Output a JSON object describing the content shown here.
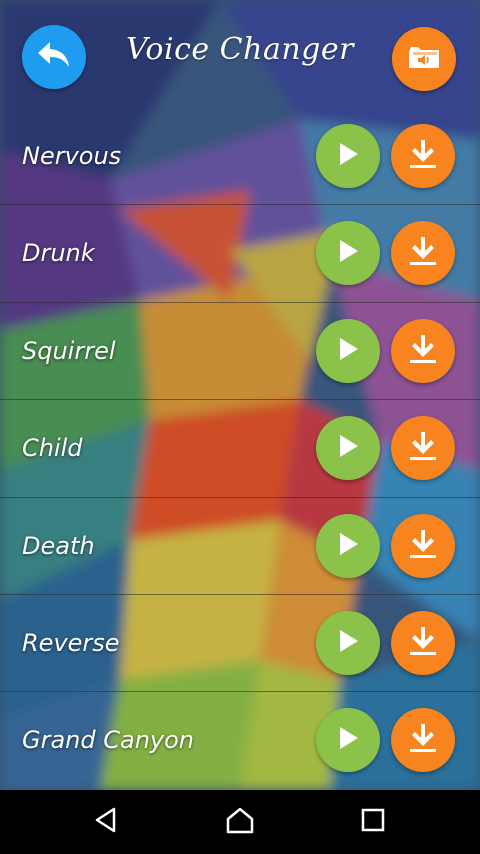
{
  "header": {
    "title": "Voice Changer",
    "back_icon": "back-arrow-icon",
    "folder_icon": "folder-audio-icon"
  },
  "effects": [
    {
      "label": "Nervous"
    },
    {
      "label": "Drunk"
    },
    {
      "label": "Squirrel"
    },
    {
      "label": "Child"
    },
    {
      "label": "Death"
    },
    {
      "label": "Reverse"
    },
    {
      "label": "Grand Canyon"
    }
  ],
  "colors": {
    "back_button": "#1e9cf0",
    "play_button": "#8bc34a",
    "download_button": "#f7841e",
    "navbar": "#000000"
  },
  "navbar": {
    "icons": [
      "nav-back-icon",
      "nav-home-icon",
      "nav-recents-icon"
    ]
  }
}
